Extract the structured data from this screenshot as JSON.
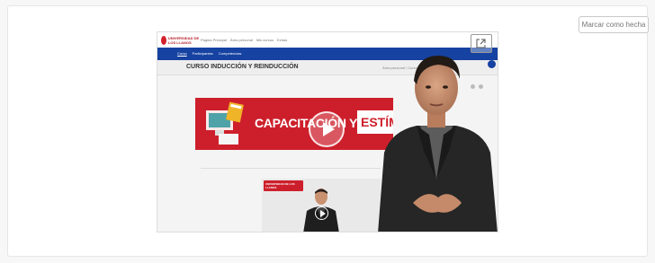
{
  "mark_done_label": "Marcar como hecha",
  "player": {
    "site_logo_text": "UNIVERSIDAD DE LOS LLANOS",
    "site_nav": [
      "Página Principal",
      "Área personal",
      "Mis cursos",
      "Extras"
    ],
    "blue_nav": [
      "Curso",
      "Participantes",
      "Competencias"
    ],
    "course_title": "CURSO INDUCCIÓN Y REINDUCCIÓN",
    "breadcrumbs": "Área personal / Cursos / ...",
    "banner_text": "CAPACITACIÓN Y",
    "banner_box_text": "ESTÍMULO",
    "thumb_logo_text": "UNIVERSIDAD DE LOS LLANOS"
  },
  "colors": {
    "brand_red": "#cd1f2b",
    "brand_blue": "#1642a1"
  },
  "icons": {
    "share": "external-link-icon",
    "play": "play-icon"
  }
}
